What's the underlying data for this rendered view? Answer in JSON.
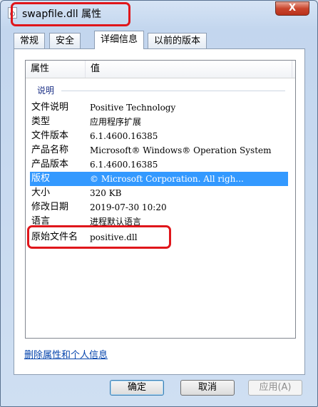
{
  "window": {
    "title": "swapfile.dll 属性",
    "close_label": "X"
  },
  "tabs": [
    {
      "label": "常规"
    },
    {
      "label": "安全"
    },
    {
      "label": "详细信息"
    },
    {
      "label": "以前的版本"
    }
  ],
  "list": {
    "columns": [
      "属性",
      "值"
    ],
    "group": "说明",
    "rows": [
      {
        "key": "文件说明",
        "value": "Positive Technology"
      },
      {
        "key": "类型",
        "value": "应用程序扩展"
      },
      {
        "key": "文件版本",
        "value": "6.1.4600.16385"
      },
      {
        "key": "产品名称",
        "value": "Microsoft® Windows® Operation System"
      },
      {
        "key": "产品版本",
        "value": "6.1.4600.16385"
      },
      {
        "key": "版权",
        "value": "© Microsoft Corporation. All righ..."
      },
      {
        "key": "大小",
        "value": "320 KB"
      },
      {
        "key": "修改日期",
        "value": "2019-07-30 10:20"
      },
      {
        "key": "语言",
        "value": "进程默认语言"
      },
      {
        "key": "原始文件名",
        "value": "positive.dll"
      }
    ]
  },
  "link": "删除属性和个人信息",
  "buttons": {
    "ok": "确定",
    "cancel": "取消",
    "apply": "应用(A)"
  }
}
